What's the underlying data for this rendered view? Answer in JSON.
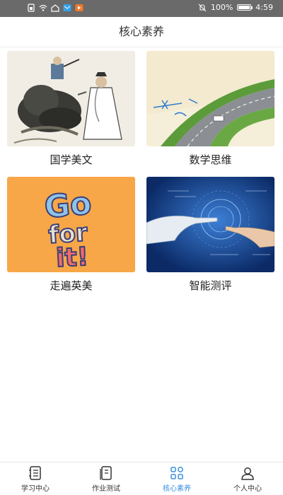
{
  "status_bar": {
    "battery": "100%",
    "time": "4:59",
    "icons": [
      "sim-icon",
      "wifi-icon",
      "app-icon",
      "mail-icon",
      "video-icon",
      "mute-icon",
      "battery-icon"
    ]
  },
  "header": {
    "title": "核心素养"
  },
  "cards": [
    {
      "label": "国学美文",
      "image": "ink-painting-scholars-illustration"
    },
    {
      "label": "数学思维",
      "image": "highway-with-math-formulas-illustration"
    },
    {
      "label": "走遍英美",
      "image": "go-for-it-lettering-illustration"
    },
    {
      "label": "智能测评",
      "image": "robot-and-human-hands-touching-illustration"
    }
  ],
  "card_art_text": {
    "go_line1": "Go",
    "go_line2": "for",
    "go_line3": "it!"
  },
  "bottom_nav": {
    "items": [
      {
        "label": "学习中心",
        "icon": "study-center-icon"
      },
      {
        "label": "作业测试",
        "icon": "homework-test-icon"
      },
      {
        "label": "核心素养",
        "icon": "core-literacy-icon"
      },
      {
        "label": "个人中心",
        "icon": "profile-icon"
      }
    ],
    "active_index": 2,
    "active_color": "#3b8fe0"
  }
}
